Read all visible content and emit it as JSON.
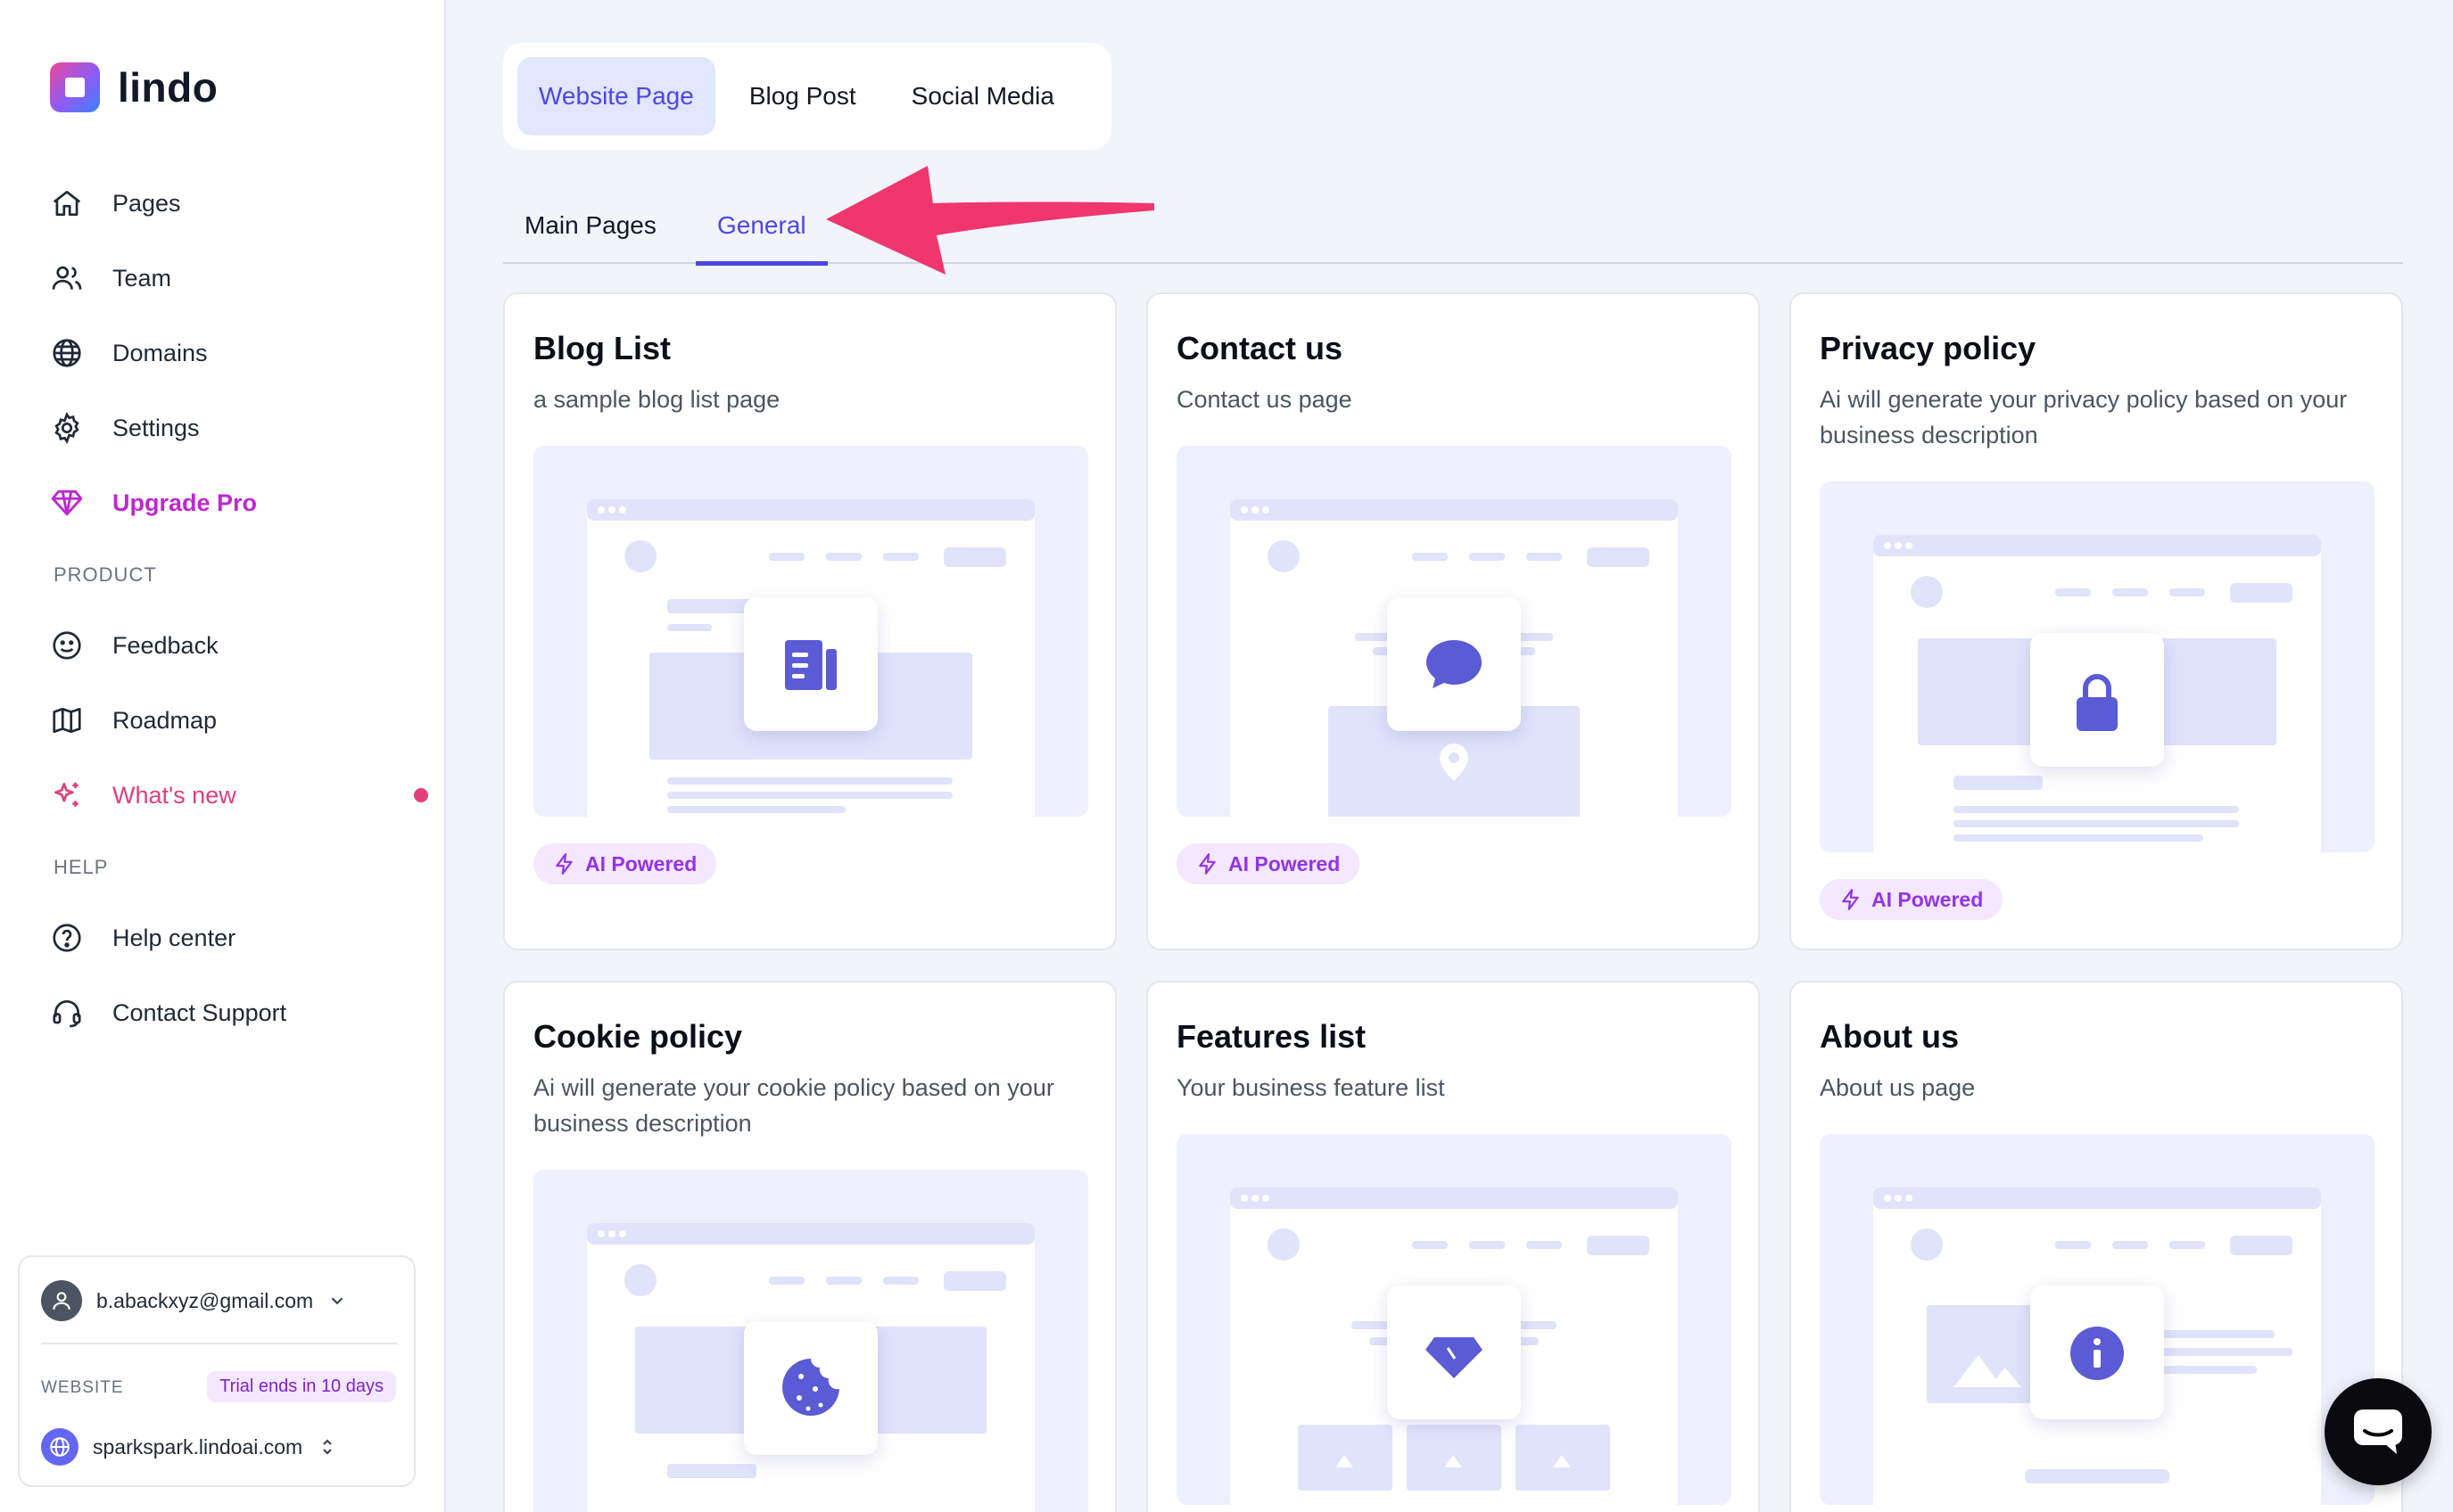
{
  "app": {
    "name": "lindo"
  },
  "sidebar": {
    "items": [
      {
        "label": "Pages",
        "icon": "home-icon"
      },
      {
        "label": "Team",
        "icon": "users-icon"
      },
      {
        "label": "Domains",
        "icon": "globe-icon"
      },
      {
        "label": "Settings",
        "icon": "gear-icon"
      },
      {
        "label": "Upgrade Pro",
        "icon": "diamond-icon"
      }
    ],
    "product_label": "PRODUCT",
    "product_items": [
      {
        "label": "Feedback",
        "icon": "smile-icon"
      },
      {
        "label": "Roadmap",
        "icon": "map-icon"
      },
      {
        "label": "What's new",
        "icon": "sparkles-icon"
      }
    ],
    "help_label": "HELP",
    "help_items": [
      {
        "label": "Help center",
        "icon": "help-circle-icon"
      },
      {
        "label": "Contact Support",
        "icon": "headset-icon"
      }
    ],
    "account": {
      "email": "b.abackxyz@gmail.com",
      "website_label": "WEBSITE",
      "trial_badge": "Trial ends in 10 days",
      "site": "sparkspark.lindoai.com"
    }
  },
  "tabs_primary": [
    "Website Page",
    "Blog Post",
    "Social Media"
  ],
  "tabs_secondary": [
    "Main Pages",
    "General"
  ],
  "cards": [
    {
      "title": "Blog List",
      "description": "a sample blog list page",
      "badge": "AI Powered",
      "icon": "blog-list-icon"
    },
    {
      "title": "Contact us",
      "description": "Contact us page",
      "badge": "AI Powered",
      "icon": "chat-bubble-icon"
    },
    {
      "title": "Privacy policy",
      "description": "Ai will generate your privacy policy based on your business description",
      "badge": "AI Powered",
      "icon": "lock-icon"
    },
    {
      "title": "Cookie policy",
      "description": "Ai will generate your cookie policy based on your business description",
      "icon": "cookie-icon"
    },
    {
      "title": "Features list",
      "description": "Your business feature list",
      "icon": "gem-icon"
    },
    {
      "title": "About us",
      "description": "About us page",
      "icon": "info-icon"
    }
  ],
  "colors": {
    "accent": "#4f46e5",
    "pro": "#c026d3",
    "new": "#e0407b",
    "arrow": "#f0366f",
    "badge_bg": "#f3e8ff"
  }
}
